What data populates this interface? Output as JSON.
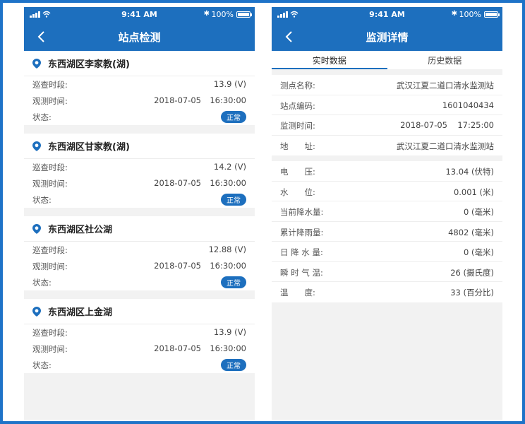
{
  "status_bar": {
    "time": "9:41 AM",
    "battery": "100%"
  },
  "left": {
    "title": "站点检测",
    "stations": [
      {
        "name": "东西湖区李家教(湖)",
        "patrol_label": "巡查时段:",
        "patrol_value": "13.9 (V)",
        "observe_label": "观测时间:",
        "observe_date": "2018-07-05",
        "observe_time": "16:30:00",
        "state_label": "状态:",
        "state_badge": "正常"
      },
      {
        "name": "东西湖区甘家教(湖)",
        "patrol_label": "巡查时段:",
        "patrol_value": "14.2 (V)",
        "observe_label": "观测时间:",
        "observe_date": "2018-07-05",
        "observe_time": "16:30:00",
        "state_label": "状态:",
        "state_badge": "正常"
      },
      {
        "name": "东西湖区社公湖",
        "patrol_label": "巡查时段:",
        "patrol_value": "12.88 (V)",
        "observe_label": "观测时间:",
        "observe_date": "2018-07-05",
        "observe_time": "16:30:00",
        "state_label": "状态:",
        "state_badge": "正常"
      },
      {
        "name": "东西湖区上金湖",
        "patrol_label": "巡查时段:",
        "patrol_value": "13.9 (V)",
        "observe_label": "观测时间:",
        "observe_date": "2018-07-05",
        "observe_time": "16:30:00",
        "state_label": "状态:",
        "state_badge": "正常"
      }
    ]
  },
  "right": {
    "title": "监测详情",
    "tabs": [
      {
        "label": "实时数据",
        "active": true
      },
      {
        "label": "历史数据",
        "active": false
      }
    ],
    "info": [
      {
        "label": "测点名称:",
        "value": "武汉江夏二道口清水监测站"
      },
      {
        "label": "站点编码:",
        "value": "1601040434"
      },
      {
        "label": "监测时间:",
        "date": "2018-07-05",
        "time": "17:25:00"
      },
      {
        "label": "地　　址:",
        "value": "武汉江夏二道口清水监测站"
      }
    ],
    "readings": [
      {
        "label": "电　　压:",
        "value": "13.04 (伏特)"
      },
      {
        "label": "水　　位:",
        "value": "0.001 (米)"
      },
      {
        "label": "当前降水量:",
        "value": "0 (毫米)"
      },
      {
        "label": "累计降雨量:",
        "value": "4802 (毫米)"
      },
      {
        "label": "日 降 水 量:",
        "value": "0 (毫米)"
      },
      {
        "label": "瞬 时 气 温:",
        "value": "26 (摄氏度)"
      },
      {
        "label": "温　　度:",
        "value": "33 (百分比)"
      }
    ]
  },
  "colors": {
    "brand": "#1d6fbe",
    "background": "#f2f2f2"
  }
}
